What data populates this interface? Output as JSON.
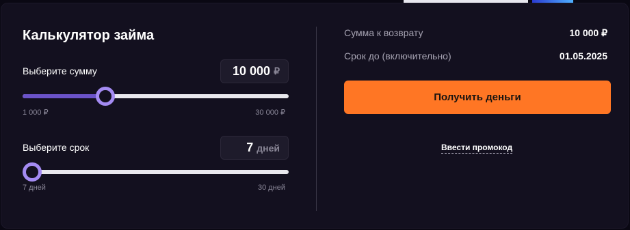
{
  "calculator": {
    "title": "Калькулятор займа",
    "amount": {
      "label": "Выберите сумму",
      "value": "10 000",
      "unit": "₽",
      "min_label": "1 000 ₽",
      "max_label": "30 000 ₽",
      "min": 1000,
      "max": 30000,
      "current": 10000
    },
    "term": {
      "label": "Выберите срок",
      "value": "7",
      "unit": "дней",
      "min_label": "7 дней",
      "max_label": "30 дней",
      "min": 7,
      "max": 30,
      "current": 7
    }
  },
  "summary": {
    "repay_label": "Сумма к возврату",
    "repay_value": "10 000 ₽",
    "due_label": "Срок до (включительно)",
    "due_value": "01.05.2025",
    "cta_label": "Получить деньги",
    "promo_label": "Ввести промокод"
  },
  "colors": {
    "accent": "#ff7624",
    "slider_thumb": "#a48bf2",
    "slider_fill": "#6b53c9",
    "background": "#13101f"
  }
}
